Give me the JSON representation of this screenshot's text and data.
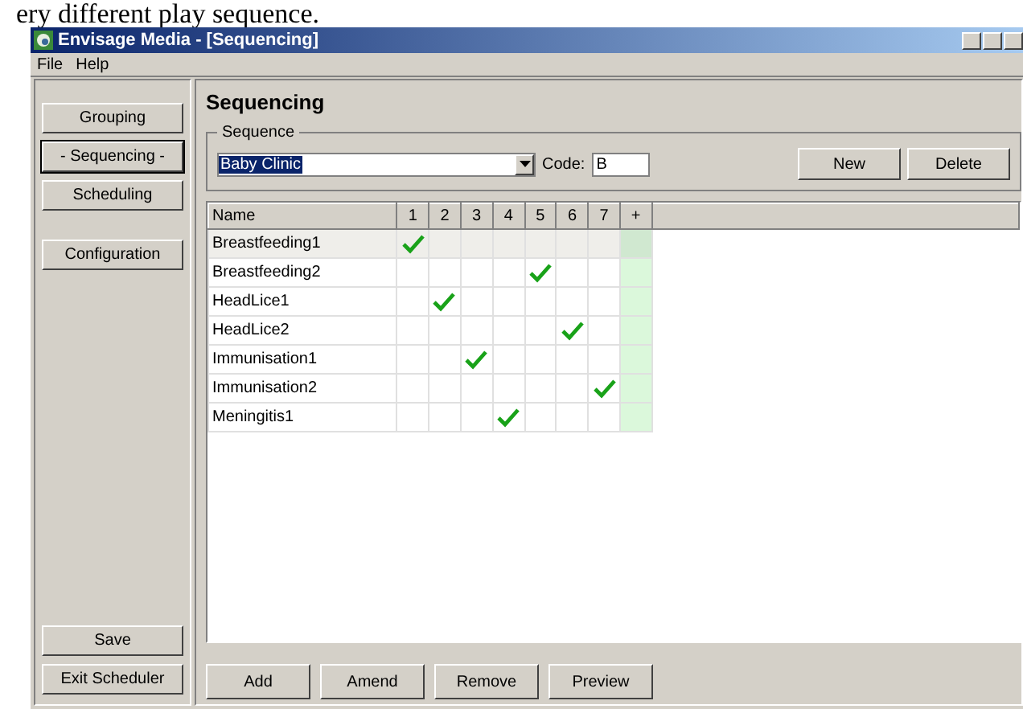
{
  "document_text": "ery different play sequence.",
  "window": {
    "title": "Envisage Media - [Sequencing]"
  },
  "menu": [
    "File",
    "Help"
  ],
  "sidebar": {
    "items": [
      {
        "label": "Grouping",
        "selected": false
      },
      {
        "label": "- Sequencing -",
        "selected": true
      },
      {
        "label": "Scheduling",
        "selected": false
      },
      {
        "label": "Configuration",
        "selected": false
      }
    ],
    "bottom_buttons": [
      "Save",
      "Exit Scheduler"
    ]
  },
  "heading": "Sequencing",
  "sequence": {
    "group_label": "Sequence",
    "value": "Baby Clinic",
    "code_label": "Code:",
    "code_value": "B",
    "buttons": [
      "New",
      "Delete"
    ]
  },
  "table": {
    "columns": [
      "Name",
      "1",
      "2",
      "3",
      "4",
      "5",
      "6",
      "7",
      "+"
    ],
    "rows": [
      {
        "name": "Breastfeeding1",
        "selected": true,
        "checks": [
          true,
          false,
          false,
          false,
          false,
          false,
          false
        ]
      },
      {
        "name": "Breastfeeding2",
        "selected": false,
        "checks": [
          false,
          false,
          false,
          false,
          true,
          false,
          false
        ]
      },
      {
        "name": "HeadLice1",
        "selected": false,
        "checks": [
          false,
          true,
          false,
          false,
          false,
          false,
          false
        ]
      },
      {
        "name": "HeadLice2",
        "selected": false,
        "checks": [
          false,
          false,
          false,
          false,
          false,
          true,
          false
        ]
      },
      {
        "name": "Immunisation1",
        "selected": false,
        "checks": [
          false,
          false,
          true,
          false,
          false,
          false,
          false
        ]
      },
      {
        "name": "Immunisation2",
        "selected": false,
        "checks": [
          false,
          false,
          false,
          false,
          false,
          false,
          true
        ]
      },
      {
        "name": "Meningitis1",
        "selected": false,
        "checks": [
          false,
          false,
          false,
          true,
          false,
          false,
          false
        ]
      }
    ]
  },
  "actions": [
    "Add",
    "Amend",
    "Remove",
    "Preview"
  ]
}
